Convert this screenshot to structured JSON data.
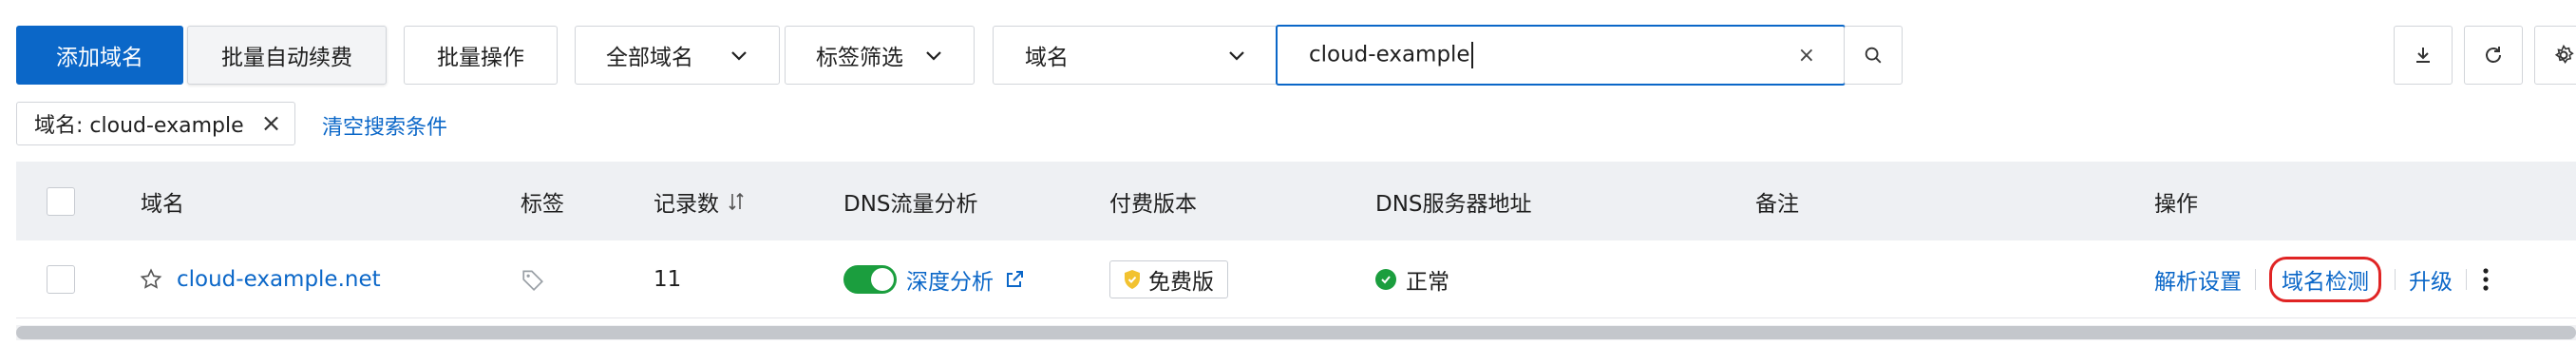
{
  "toolbar": {
    "add_domain": "添加域名",
    "batch_auto_renew": "批量自动续费",
    "batch_ops": "批量操作",
    "all_domains": "全部域名",
    "tag_filter": "标签筛选",
    "search_field": "域名",
    "search_value": "cloud-example",
    "clear_glyph": "×"
  },
  "filter": {
    "chip_label": "域名: cloud-example",
    "chip_close": "×",
    "clear_link": "清空搜索条件"
  },
  "table": {
    "headers": {
      "domain": "域名",
      "tags": "标签",
      "records": "记录数",
      "dns_traffic": "DNS流量分析",
      "edition": "付费版本",
      "dns_server": "DNS服务器地址",
      "remark": "备注",
      "actions": "操作"
    },
    "rows": [
      {
        "domain": "cloud-example.net",
        "records": "11",
        "dns_traffic_link": "深度分析",
        "edition": "免费版",
        "dns_status": "正常",
        "actions": [
          "解析设置",
          "域名检测",
          "升级"
        ]
      }
    ]
  },
  "colors": {
    "primary": "#0b67c8",
    "success": "#1b9e3e",
    "highlight_border": "#e02424"
  },
  "icons": [
    "chevron-down-icon",
    "search-icon",
    "download-icon",
    "refresh-icon",
    "settings-icon",
    "tag-icon",
    "star-icon",
    "external-link-icon",
    "shield-icon",
    "check-circle-icon",
    "more-vertical-icon",
    "sort-icon"
  ]
}
